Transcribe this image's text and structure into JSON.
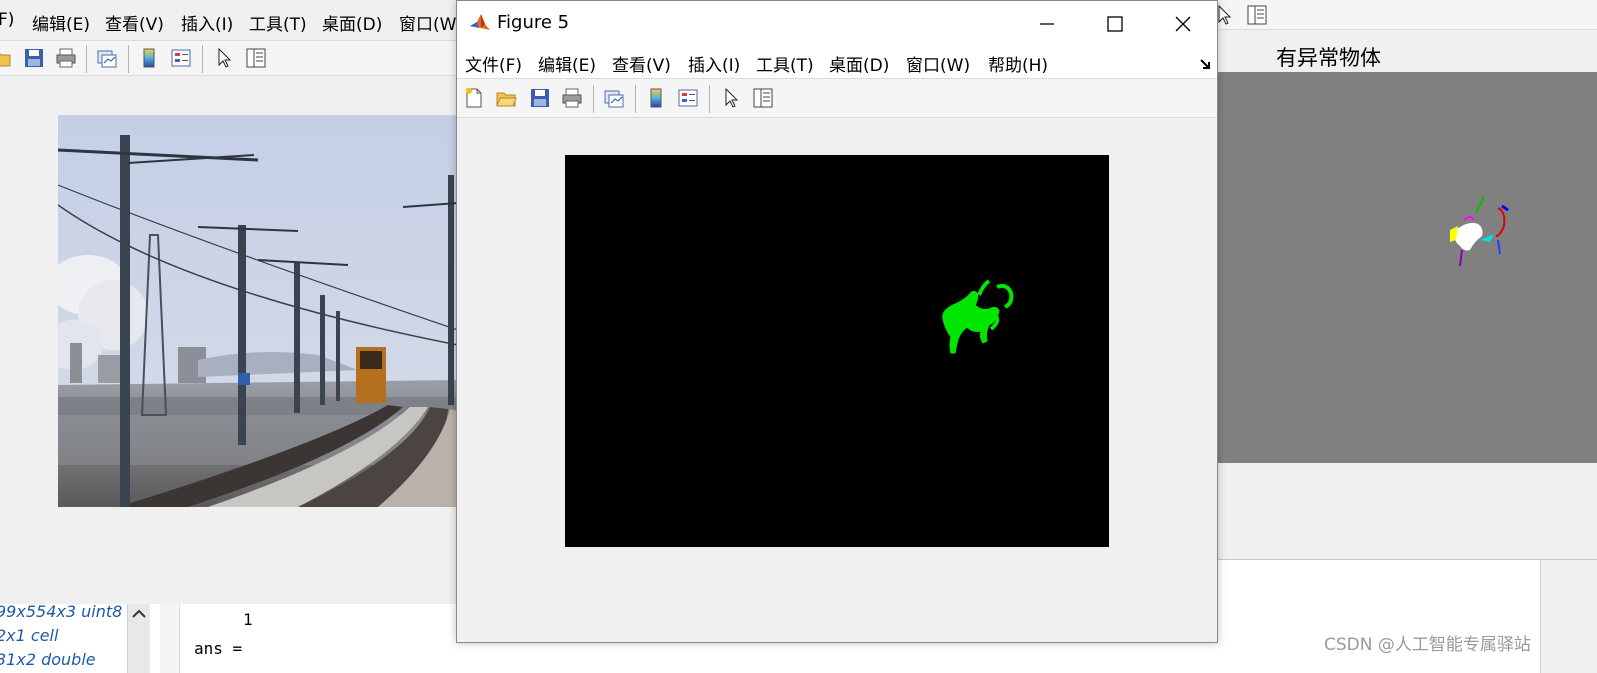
{
  "background_window": {
    "menu": [
      "F)",
      "编辑(E)",
      "查看(V)",
      "插入(I)",
      "工具(T)",
      "桌面(D)",
      "窗口(W"
    ],
    "workspace_rows": [
      "99x554x3 uint8",
      "2x1 cell",
      "31x2 double"
    ],
    "command_lines": [
      "1",
      "ans ="
    ]
  },
  "right_window": {
    "axes_title": "有异常物体"
  },
  "figure5": {
    "title": "Figure 5",
    "menu": [
      "文件(F)",
      "编辑(E)",
      "查看(V)",
      "插入(I)",
      "工具(T)",
      "桌面(D)",
      "窗口(W)",
      "帮助(H)"
    ],
    "toolbar_icons": [
      "new-file-icon",
      "open-folder-icon",
      "save-icon",
      "print-icon",
      "link-plot-icon",
      "colorbar-icon",
      "legend-icon",
      "pointer-icon",
      "property-inspector-icon"
    ],
    "window_controls": [
      "minimize-icon",
      "maximize-icon",
      "close-icon"
    ],
    "blob_color": "#00e600",
    "axes_background": "#000000"
  },
  "watermark": "CSDN @人工智能专属驿站"
}
